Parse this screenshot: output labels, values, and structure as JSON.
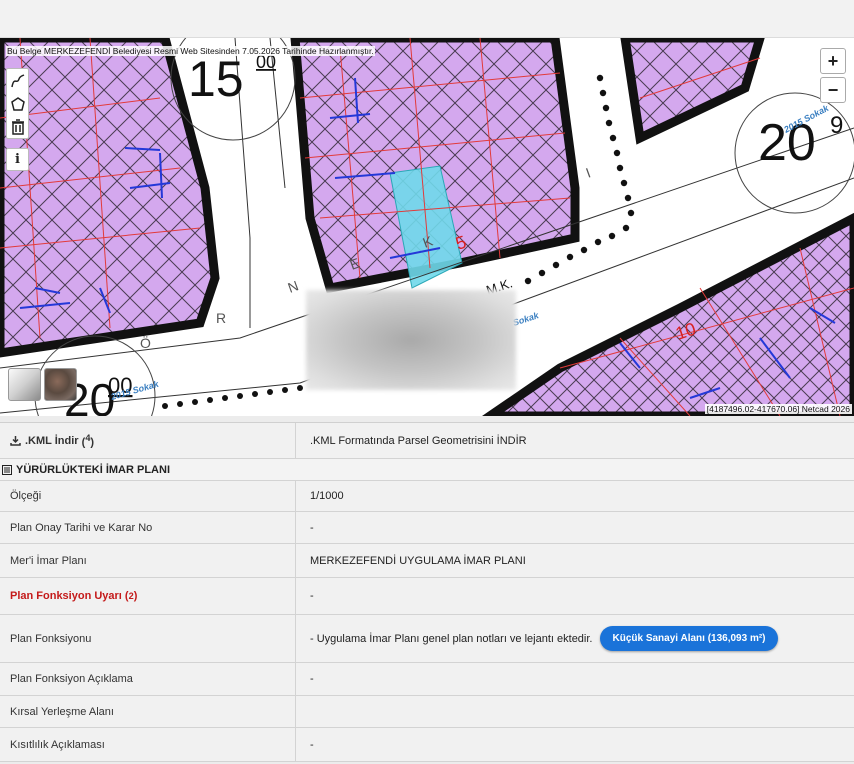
{
  "map": {
    "notice": "Bu Belge MERKEZEFENDİ Belediyesi Resmi Web Sitesinden 7.05.2026 Tarihinde Hazırlanmıştır.",
    "coords": "[4187496.02-417670.06] Netcad 2026",
    "zoom_in": "+",
    "zoom_out": "−",
    "info": "i",
    "labels": {
      "block_15": "15",
      "block_15_sup": "00",
      "block_20": "20",
      "block_20_sup": "9",
      "block_20b": "20",
      "block_20b_sup": "00",
      "street_1": "2015 Sokak",
      "street_2": "2015 Sokak",
      "street_3": "Sokak",
      "mk": "M.K.",
      "n_10": "10",
      "n_5": "5",
      "letters": [
        "N",
        "E",
        "K",
        "Ö",
        "R",
        "I"
      ]
    }
  },
  "kml": {
    "label": ".KML İndir",
    "sup": "4",
    "link": ".KML Formatında Parsel Geometrisini İNDİR"
  },
  "section_title": "YÜRÜRLÜKTEKİ İMAR PLANI",
  "rows": [
    {
      "label": "Ölçeği",
      "value": "1/1000"
    },
    {
      "label": "Plan Onay Tarihi ve Karar No",
      "value": "-"
    },
    {
      "label": "Mer'i İmar Planı",
      "value": "MERKEZEFENDİ UYGULAMA İMAR PLANI"
    },
    {
      "label": "Plan Fonksiyon Uyarı",
      "sup": "2",
      "value": "-"
    },
    {
      "label": "Plan Fonksiyonu",
      "value": "- Uygulama İmar Planı genel plan notları ve lejantı ektedir.",
      "pill": "Küçük Sanayi Alanı (136,093 m²)"
    },
    {
      "label": "Plan Fonksiyon Açıklama",
      "value": "-"
    },
    {
      "label": "Kırsal Yerleşme Alanı",
      "value": ""
    },
    {
      "label": "Kısıtlılık Açıklaması",
      "value": "-"
    }
  ],
  "colors": {
    "parcel_purple": "#d4a8ee",
    "hatch": "#4a3c52",
    "highlight": "#6fd8ea",
    "pill_blue": "#1a73d9",
    "warning_red": "#c41a1a",
    "link_blue": "#2b64a8"
  }
}
